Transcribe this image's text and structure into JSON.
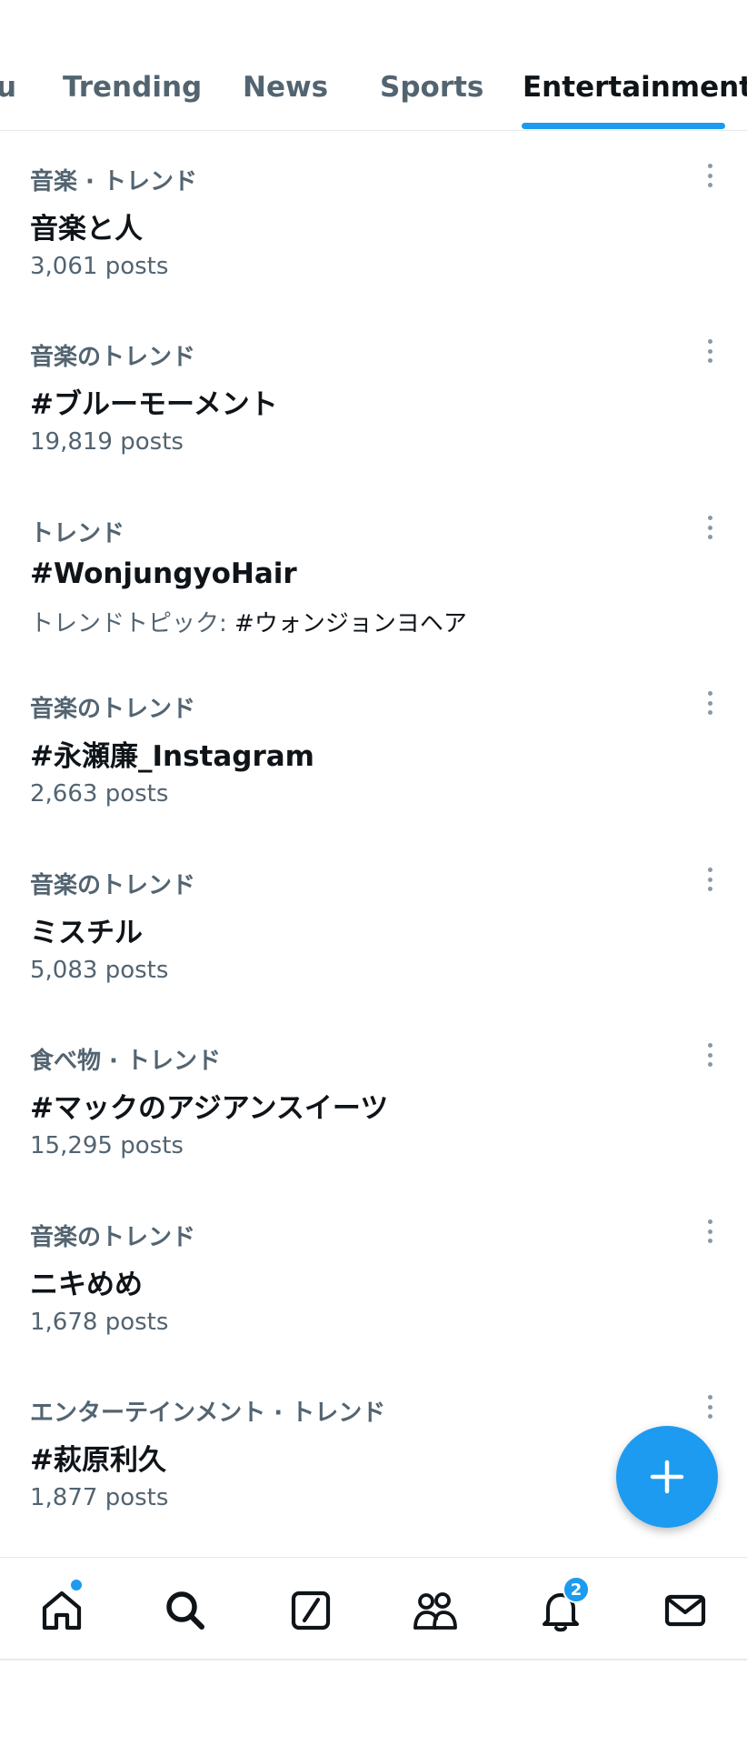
{
  "tabs": [
    {
      "label": "u",
      "active": false
    },
    {
      "label": "Trending",
      "active": false
    },
    {
      "label": "News",
      "active": false
    },
    {
      "label": "Sports",
      "active": false
    },
    {
      "label": "Entertainment",
      "active": true
    }
  ],
  "trends": [
    {
      "context": "音楽 · トレンド",
      "name": "音楽と人",
      "meta": "3,061 posts"
    },
    {
      "context": "音楽のトレンド",
      "name": "#ブルーモーメント",
      "meta": "19,819 posts"
    },
    {
      "context": "トレンド",
      "name": "#WonjungyoHair",
      "meta_prefix": "トレンドトピック: ",
      "meta_topic": "#ウォンジョンヨヘア"
    },
    {
      "context": "音楽のトレンド",
      "name": "#永瀬廉_Instagram",
      "meta": "2,663 posts"
    },
    {
      "context": "音楽のトレンド",
      "name": "ミスチル",
      "meta": "5,083 posts"
    },
    {
      "context": "食べ物 · トレンド",
      "name": "#マックのアジアンスイーツ",
      "meta": "15,295 posts"
    },
    {
      "context": "音楽のトレンド",
      "name": "ニキめめ",
      "meta": "1,678 posts"
    },
    {
      "context": "エンターテインメント · トレンド",
      "name": "#萩原利久",
      "meta": "1,877 posts"
    }
  ],
  "nav": {
    "notifications_badge": "2"
  },
  "colors": {
    "accent": "#1d9bf0",
    "secondary_text": "#536471",
    "primary_text": "#0f1419"
  }
}
